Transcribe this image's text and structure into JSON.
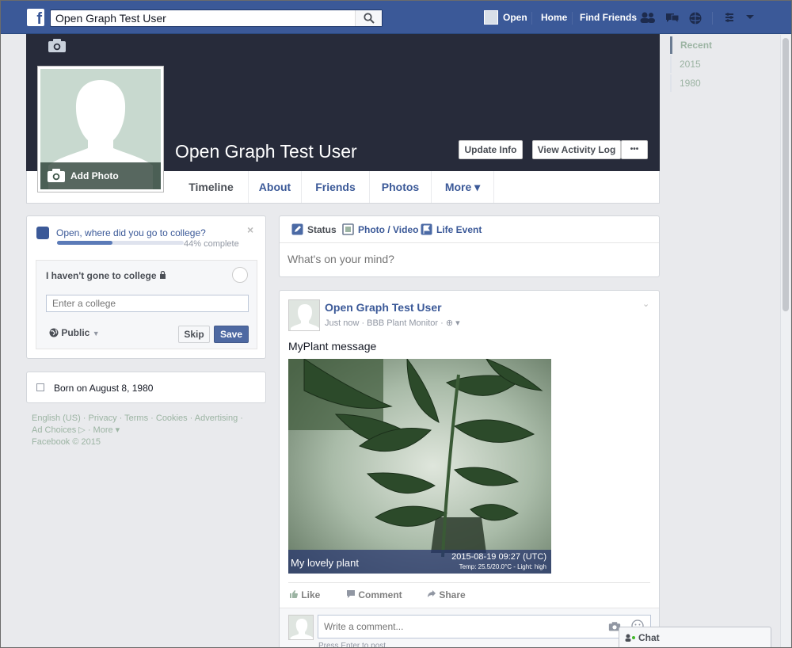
{
  "topbar": {
    "logo": "f",
    "search_value": "Open Graph Test User",
    "nav": {
      "profile": "Open",
      "home": "Home",
      "find_friends": "Find Friends"
    },
    "icons": [
      "search-icon",
      "friend-requests-icon",
      "messages-icon",
      "notifications-icon",
      "privacy-icon",
      "account-menu-icon"
    ]
  },
  "cover": {
    "name": "Open Graph Test User",
    "add_photo": "Add Photo",
    "buttons": {
      "update_info": "Update Info",
      "activity_log": "View Activity Log",
      "more": "•••"
    }
  },
  "tabs": [
    {
      "label": "Timeline",
      "active": true
    },
    {
      "label": "About"
    },
    {
      "label": "Friends"
    },
    {
      "label": "Photos"
    },
    {
      "label": "More ▾"
    }
  ],
  "timeline_nav": [
    "Recent",
    "2015",
    "1980"
  ],
  "college_prompt": {
    "question": "Open, where did you go to college?",
    "progress_percent": 44,
    "progress_text": "44% complete",
    "option_label": "I haven't gone to college",
    "input_placeholder": "Enter a college",
    "privacy": "Public",
    "skip": "Skip",
    "save": "Save"
  },
  "born": {
    "text": "Born on August 8, 1980"
  },
  "footer": {
    "line1": "English (US) · Privacy · Terms · Cookies · Advertising ·",
    "line2": "Ad Choices ▷ · More ▾",
    "line3": "Facebook © 2015"
  },
  "composer": {
    "tabs": {
      "status": "Status",
      "photo_video": "Photo / Video",
      "life_event": "Life Event"
    },
    "placeholder": "What's on your mind?"
  },
  "post": {
    "author": "Open Graph Test User",
    "meta": "Just now · BBB Plant Monitor · ⊕ ▾",
    "message": "MyPlant message",
    "photo_caption": "My lovely plant",
    "photo_timestamp": "2015-08-19 09:27 (UTC)",
    "photo_temp": "Temp: 25.5/20.0°C - Light: high",
    "actions": {
      "like": "Like",
      "comment": "Comment",
      "share": "Share"
    },
    "comment_placeholder": "Write a comment...",
    "comment_hint": "Press Enter to post."
  },
  "chat": {
    "label": "Chat"
  },
  "colors": {
    "brand": "#3b5998",
    "cover": "#272b3a",
    "background": "#e9eaed"
  }
}
